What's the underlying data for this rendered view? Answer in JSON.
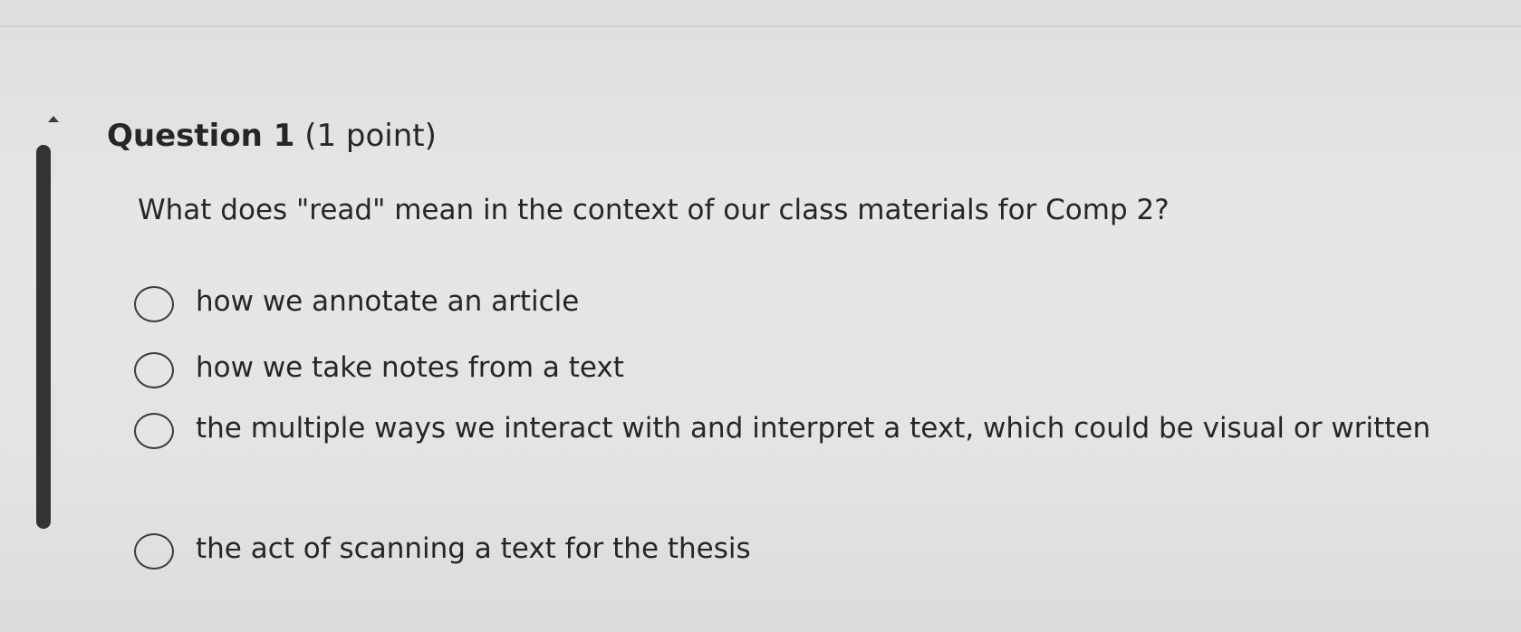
{
  "question": {
    "title": "Question 1",
    "points": "(1 point)",
    "text": "What does \"read\" mean in the context of our class materials for Comp 2?"
  },
  "options": [
    {
      "label": "how we annotate an article"
    },
    {
      "label": "how we take notes from a text"
    },
    {
      "label": "the multiple ways we interact with and interpret a text, which could be visual or written"
    },
    {
      "label": "the act of scanning a text for the thesis"
    }
  ],
  "icons": {
    "collapse": "caret-up-icon"
  },
  "colors": {
    "background": "#e4e4e2",
    "text": "#262626",
    "accent_bar": "#333333",
    "radio_border": "#3a3a3a"
  }
}
